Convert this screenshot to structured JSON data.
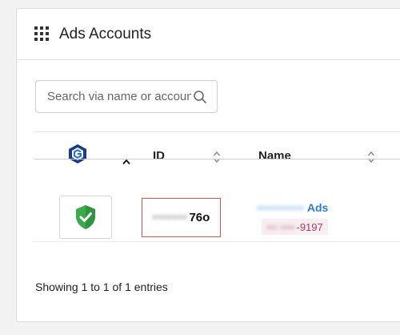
{
  "header": {
    "title": "Ads Accounts",
    "icon": "grid-icon"
  },
  "search": {
    "placeholder": "Search via name or account",
    "icon": "search-icon"
  },
  "table": {
    "columns": [
      {
        "key": "logo",
        "label": "",
        "icon": "brand-logo-icon"
      },
      {
        "key": "id",
        "label": "ID"
      },
      {
        "key": "name",
        "label": "Name"
      }
    ],
    "rows": [
      {
        "status_icon": "shield-check-icon",
        "id_masked": "•••••••",
        "id_suffix": "76o",
        "name_masked": "••••••••••••",
        "name_suffix": "Ads",
        "phone_masked": "••• ••••",
        "phone_suffix": "-9197"
      }
    ]
  },
  "footer": {
    "entries_text": "Showing 1 to 1 of 1 entries"
  },
  "colors": {
    "accent_link": "#2a7fd4",
    "highlight_border": "#d9534f",
    "shield_green": "#3aaa4a",
    "phone_text": "#b03a5b"
  }
}
